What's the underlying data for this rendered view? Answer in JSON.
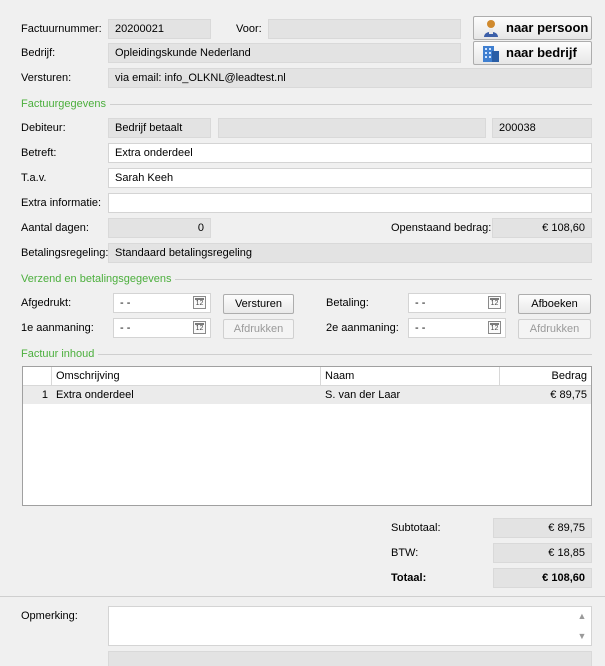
{
  "header": {
    "invoice_number_label": "Factuurnummer:",
    "invoice_number": "20200021",
    "for_label": "Voor:",
    "for_value": "",
    "company_label": "Bedrijf:",
    "company": "Opleidingskunde Nederland",
    "send_label": "Versturen:",
    "send_value": "via email: info_OLKNL@leadtest.nl",
    "to_person_button": "naar persoon",
    "to_company_button": "naar bedrijf"
  },
  "invoice_details": {
    "section_title": "Factuurgegevens",
    "debtor_label": "Debiteur:",
    "debtor_type": "Bedrijf betaalt",
    "debtor_middle": "",
    "debtor_number": "200038",
    "subject_label": "Betreft:",
    "subject": "Extra onderdeel",
    "attn_label": "T.a.v.",
    "attn": "Sarah Keeh",
    "extra_info_label": "Extra informatie:",
    "extra_info": "",
    "days_label": "Aantal dagen:",
    "days": "0",
    "outstanding_label": "Openstaand bedrag:",
    "outstanding": "€ 108,60",
    "payment_plan_label": "Betalingsregeling:",
    "payment_plan": "Standaard betalingsregeling"
  },
  "shipping": {
    "section_title": "Verzend en betalingsgegevens",
    "printed_label": "Afgedrukt:",
    "printed_date": "-  -",
    "send_button": "Versturen",
    "payment_label": "Betaling:",
    "payment_date": "-  -",
    "book_button": "Afboeken",
    "reminder1_label": "1e aanmaning:",
    "reminder1_date": "-  -",
    "print1_button": "Afdrukken",
    "reminder2_label": "2e aanmaning:",
    "reminder2_date": "-  -",
    "print2_button": "Afdrukken",
    "calendar_glyph": "12"
  },
  "contents": {
    "section_title": "Factuur inhoud",
    "columns": [
      "Omschrijving",
      "Naam",
      "Bedrag"
    ],
    "rows": [
      {
        "nr": "1",
        "description": "Extra onderdeel",
        "name": "S. van der Laar",
        "amount": "€ 89,75"
      }
    ]
  },
  "totals": {
    "subtotal_label": "Subtotaal:",
    "subtotal": "€ 89,75",
    "vat_label": "BTW:",
    "vat": "€ 18,85",
    "total_label": "Totaal:",
    "total": "€ 108,60"
  },
  "remark": {
    "label": "Opmerking:",
    "value": ""
  }
}
